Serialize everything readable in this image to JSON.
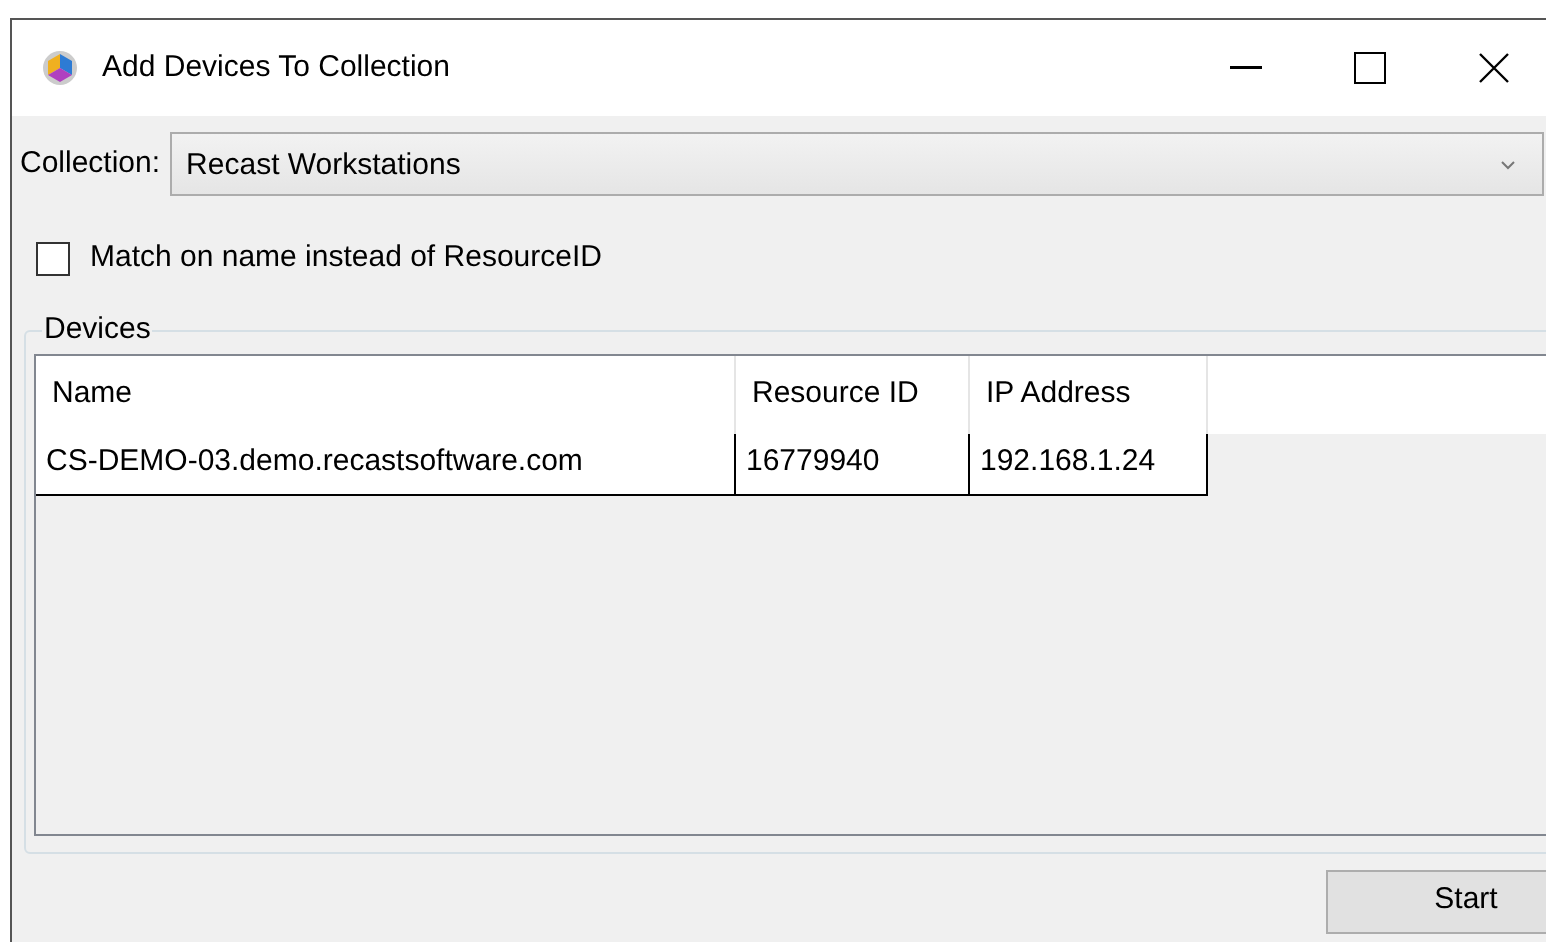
{
  "window": {
    "title": "Add Devices To Collection"
  },
  "collection": {
    "label": "Collection:",
    "value": "Recast Workstations"
  },
  "match_option": {
    "label": "Match on name instead of ResourceID",
    "checked": false
  },
  "devices": {
    "title": "Devices",
    "columns": [
      "Name",
      "Resource ID",
      "IP Address"
    ],
    "rows": [
      [
        "CS-DEMO-03.demo.recastsoftware.com",
        "16779940",
        "192.168.1.24"
      ]
    ]
  },
  "buttons": [
    "Start"
  ]
}
